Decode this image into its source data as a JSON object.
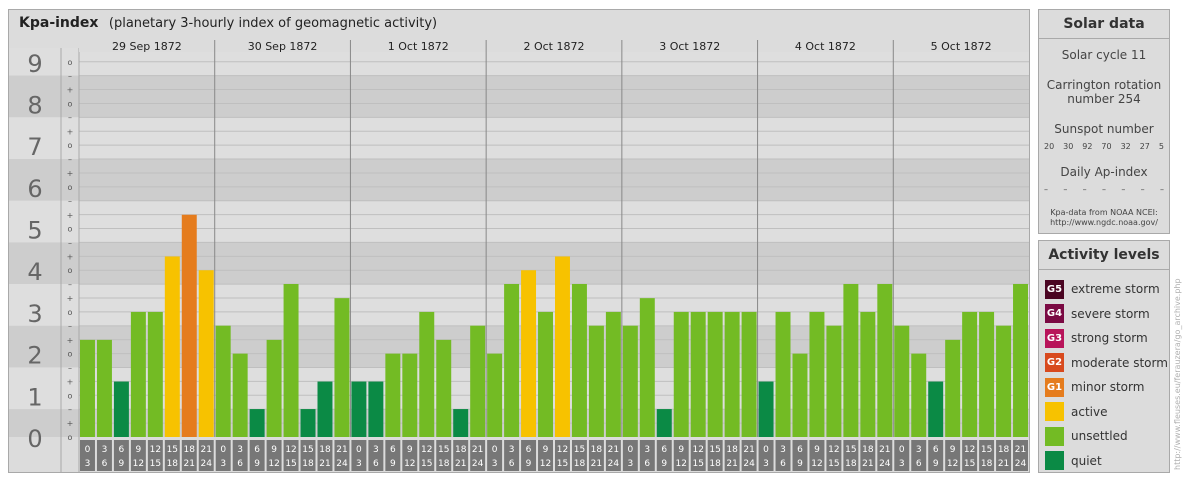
{
  "header": {
    "title": "Kpa-index",
    "subtitle": "(planetary 3-hourly index of geomagnetic activity)"
  },
  "chart_data": {
    "type": "bar",
    "y_levels": [
      "0",
      "1",
      "2",
      "3",
      "4",
      "5",
      "6",
      "7",
      "8",
      "9"
    ],
    "y_sub_labels": [
      "o",
      "+",
      "–"
    ],
    "ylim": [
      0,
      9.33
    ],
    "days": [
      "29 Sep 1872",
      "30 Sep 1872",
      "1 Oct 1872",
      "2 Oct 1872",
      "3 Oct 1872",
      "4 Oct 1872",
      "5 Oct 1872"
    ],
    "slots": [
      [
        "0",
        "3"
      ],
      [
        "3",
        "6"
      ],
      [
        "6",
        "9"
      ],
      [
        "9",
        "12"
      ],
      [
        "12",
        "15"
      ],
      [
        "15",
        "18"
      ],
      [
        "18",
        "21"
      ],
      [
        "21",
        "24"
      ]
    ],
    "values": [
      [
        2.33,
        2.33,
        1.33,
        3.0,
        3.0,
        4.33,
        5.33,
        4.0
      ],
      [
        2.67,
        2.0,
        0.67,
        2.33,
        3.67,
        0.67,
        1.33,
        3.33
      ],
      [
        1.33,
        1.33,
        2.0,
        2.0,
        3.0,
        2.33,
        0.67,
        2.67
      ],
      [
        2.0,
        3.67,
        4.0,
        3.0,
        4.33,
        3.67,
        2.67,
        3.0
      ],
      [
        2.67,
        3.33,
        0.67,
        3.0,
        3.0,
        3.0,
        3.0,
        3.0
      ],
      [
        1.33,
        3.0,
        2.0,
        3.0,
        2.67,
        3.67,
        3.0,
        3.67
      ],
      [
        2.67,
        2.0,
        1.33,
        2.33,
        3.0,
        3.0,
        2.67,
        3.67
      ]
    ],
    "colors": {
      "quiet": "#0b8a45",
      "unsettled": "#73bb24",
      "active": "#f7c200",
      "minor_storm": "#e57c1d"
    }
  },
  "solar": {
    "heading": "Solar data",
    "cycle": "Solar cycle 11",
    "carrington_line1": "Carrington rotation",
    "carrington_line2": "number 254",
    "sunspot_heading": "Sunspot number",
    "sunspot_values": [
      "20",
      "30",
      "92",
      "70",
      "32",
      "27",
      "5"
    ],
    "ap_heading": "Daily Ap-index",
    "ap_values": [
      "–",
      "–",
      "–",
      "–",
      "–",
      "–",
      "–"
    ],
    "source_line1": "Kpa-data from NOAA NCEI:",
    "source_line2": "http://www.ngdc.noaa.gov/"
  },
  "levels": {
    "heading": "Activity levels",
    "items": [
      {
        "code": "G5",
        "label": "extreme storm",
        "color": "#4a0522"
      },
      {
        "code": "G4",
        "label": "severe storm",
        "color": "#7a0a43"
      },
      {
        "code": "G3",
        "label": "strong storm",
        "color": "#b8145a"
      },
      {
        "code": "G2",
        "label": "moderate storm",
        "color": "#d84a1e"
      },
      {
        "code": "G1",
        "label": "minor storm",
        "color": "#e57c1d"
      },
      {
        "code": "",
        "label": "active",
        "color": "#f7c200"
      },
      {
        "code": "",
        "label": "unsettled",
        "color": "#73bb24"
      },
      {
        "code": "",
        "label": "quiet",
        "color": "#0b8a45"
      }
    ]
  },
  "watermark": "http://www.fleuses.eu/ferauzera/go_archive.php"
}
